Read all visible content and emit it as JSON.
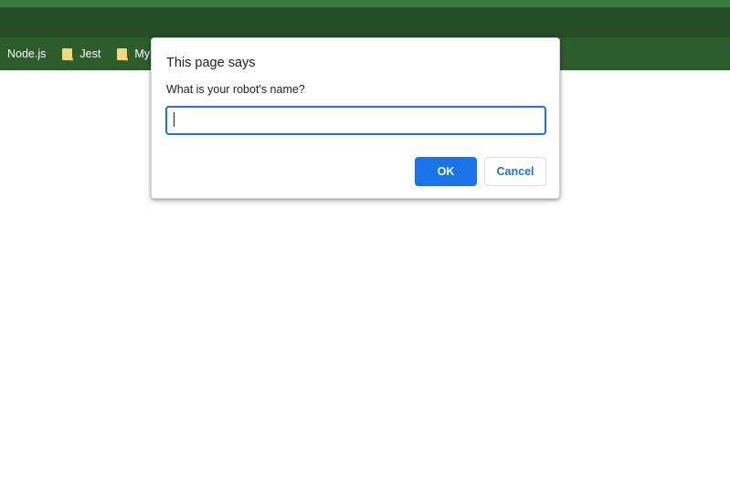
{
  "bookmarks": [
    {
      "label": "Node.js",
      "icon": "none"
    },
    {
      "label": "Jest",
      "icon": "folder-icon"
    },
    {
      "label": "My",
      "icon": "folder-icon"
    }
  ],
  "dialog": {
    "title": "This page says",
    "message": "What is your robot's name?",
    "input_value": "",
    "ok_label": "OK",
    "cancel_label": "Cancel"
  },
  "colors": {
    "chrome_green": "#2b5a2b",
    "accent_blue": "#1a73e8",
    "folder_yellow": "#f5d77b"
  }
}
